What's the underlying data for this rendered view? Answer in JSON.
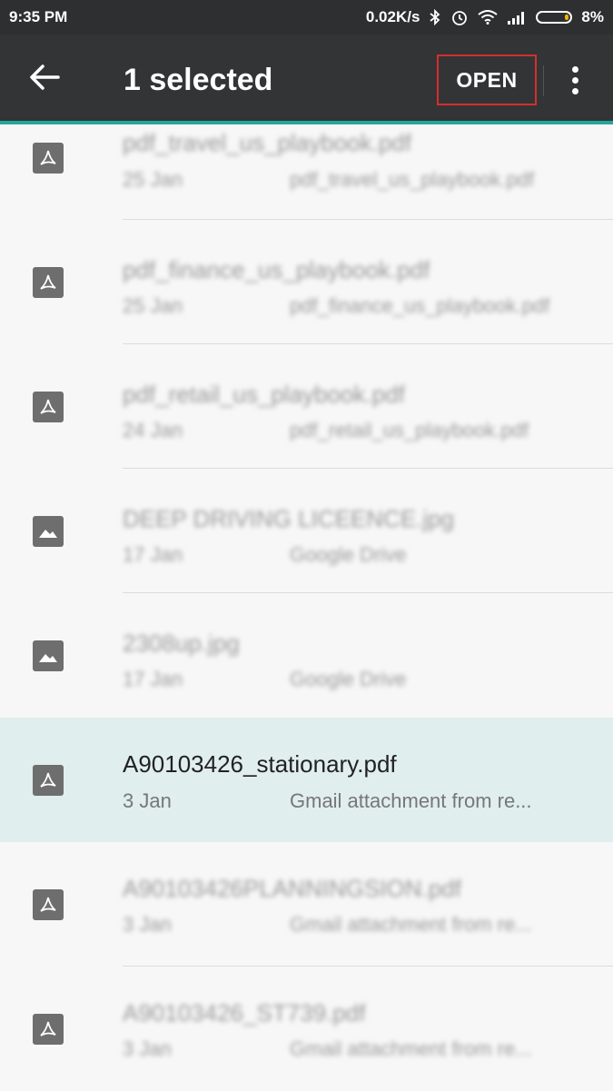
{
  "status": {
    "time": "9:35 PM",
    "speed": "0.02K/s",
    "battery": "8%"
  },
  "toolbar": {
    "title": "1 selected",
    "open_label": "OPEN"
  },
  "files": [
    {
      "name": "pdf_travel_us_playbook.pdf",
      "date": "25 Jan",
      "source": "pdf_travel_us_playbook.pdf",
      "type": "pdf"
    },
    {
      "name": "pdf_finance_us_playbook.pdf",
      "date": "25 Jan",
      "source": "pdf_finance_us_playbook.pdf",
      "type": "pdf"
    },
    {
      "name": "pdf_retail_us_playbook.pdf",
      "date": "24 Jan",
      "source": "pdf_retail_us_playbook.pdf",
      "type": "pdf"
    },
    {
      "name": "DEEP DRIVING LICEENCE.jpg",
      "date": "17 Jan",
      "source": "Google Drive",
      "type": "image"
    },
    {
      "name": "2308up.jpg",
      "date": "17 Jan",
      "source": "Google Drive",
      "type": "image"
    },
    {
      "name": "A90103426_stationary.pdf",
      "date": "3 Jan",
      "source": "Gmail attachment from re...",
      "type": "pdf"
    },
    {
      "name": "A90103426PLANNINGSION.pdf",
      "date": "3 Jan",
      "source": "Gmail attachment from re...",
      "type": "pdf"
    },
    {
      "name": "A90103426_ST739.pdf",
      "date": "3 Jan",
      "source": "Gmail attachment from re...",
      "type": "pdf"
    }
  ]
}
